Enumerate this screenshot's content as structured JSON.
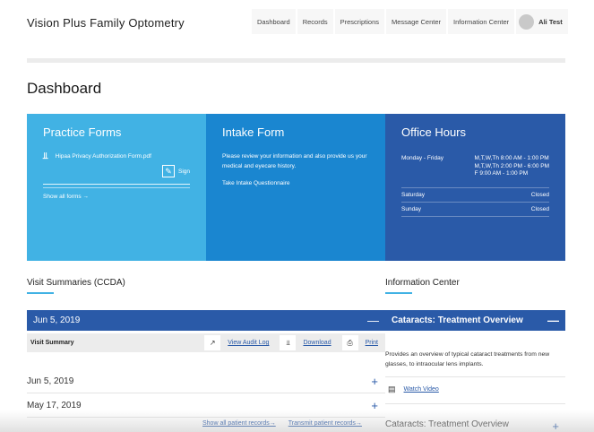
{
  "header": {
    "brand": "Vision Plus Family Optometry",
    "nav": [
      "Dashboard",
      "Records",
      "Prescriptions",
      "Message Center",
      "Information Center"
    ],
    "user": "Ali Test"
  },
  "page_title": "Dashboard",
  "cards": {
    "forms": {
      "title": "Practice Forms",
      "file": "Hipaa Privacy Authorization Form.pdf",
      "sign": "Sign",
      "show_all": "Show all forms →"
    },
    "intake": {
      "title": "Intake Form",
      "text": "Please review your information and also provide us your medical and eyecare history.",
      "link": "Take Intake Questionnaire"
    },
    "hours": {
      "title": "Office Hours",
      "rows": [
        {
          "day": "Monday - Friday",
          "times": [
            "M,T,W,Th 8:00 AM - 1:00 PM",
            "M,T,W,Th 2:00 PM - 6:00 PM",
            "F 9:00 AM - 1:00 PM"
          ]
        },
        {
          "day": "Saturday",
          "times": [
            "Closed"
          ]
        },
        {
          "day": "Sunday",
          "times": [
            "Closed"
          ]
        }
      ]
    }
  },
  "visits": {
    "title": "Visit Summaries (CCDA)",
    "open_date": "Jun 5, 2019",
    "summary_label": "Visit Summary",
    "audit_log": "View Audit Log",
    "download": "Download",
    "print": "Print",
    "rows": [
      "Jun 5, 2019",
      "May 17, 2019"
    ],
    "show_all": "Show all patient records→",
    "transmit": "Transmit patient records→"
  },
  "info_center": {
    "title": "Information Center",
    "item_title": "Cataracts: Treatment Overview",
    "description": "Provides an overview of typical cataract treatments from new glasses, to intraocular lens implants.",
    "watch_video": "Watch Video",
    "item2_title": "Cataracts: Treatment Overview"
  },
  "colors": {
    "light_blue": "#41b2e4",
    "mid_blue": "#1a86d0",
    "dark_blue": "#2a5aa8"
  }
}
